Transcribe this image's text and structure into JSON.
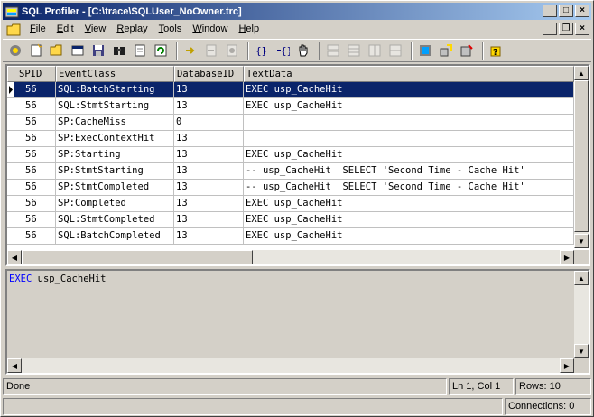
{
  "window": {
    "title": "SQL Profiler - [C:\\trace\\SQLUser_NoOwner.trc]",
    "caption_buttons": [
      "_",
      "□",
      "×"
    ]
  },
  "menu": {
    "items": [
      {
        "label": "File",
        "accel": "F",
        "rest": "ile"
      },
      {
        "label": "Edit",
        "accel": "E",
        "rest": "dit"
      },
      {
        "label": "View",
        "accel": "V",
        "rest": "iew"
      },
      {
        "label": "Replay",
        "accel": "R",
        "rest": "eplay"
      },
      {
        "label": "Tools",
        "accel": "T",
        "rest": "ools"
      },
      {
        "label": "Window",
        "accel": "W",
        "rest": "indow"
      },
      {
        "label": "Help",
        "accel": "H",
        "rest": "elp"
      }
    ],
    "mdi_buttons": [
      "_",
      "❐",
      "×"
    ]
  },
  "toolbar": {
    "icons": [
      "new-trace-icon",
      "new-template-icon",
      "open-icon",
      "properties-icon",
      "save-icon",
      "find-icon",
      "clear-trace-icon",
      "replay-icon",
      "step-icon",
      "run-to-cursor-icon",
      "toggle-breakpoint-icon",
      "stop-icon",
      "pause-icon",
      "window-tile-icon",
      "window-cascade-icon",
      "window-horizontal-icon",
      "window-vertical-icon",
      "query-analyzer-icon",
      "performance-monitor-icon",
      "index-tuning-icon",
      "help-icon"
    ]
  },
  "grid": {
    "columns": [
      "SPID",
      "EventClass",
      "DatabaseID",
      "TextData"
    ],
    "rows": [
      {
        "spid": "56",
        "event": "SQL:BatchStarting",
        "db": "13",
        "text": "EXEC usp_CacheHit",
        "selected": true
      },
      {
        "spid": "56",
        "event": "SQL:StmtStarting",
        "db": "13",
        "text": "EXEC usp_CacheHit"
      },
      {
        "spid": "56",
        "event": "SP:CacheMiss",
        "db": "0",
        "text": ""
      },
      {
        "spid": "56",
        "event": "SP:ExecContextHit",
        "db": "13",
        "text": ""
      },
      {
        "spid": "56",
        "event": "SP:Starting",
        "db": "13",
        "text": "EXEC usp_CacheHit"
      },
      {
        "spid": "56",
        "event": "SP:StmtStarting",
        "db": "13",
        "text": "-- usp_CacheHit  SELECT 'Second Time - Cache Hit'"
      },
      {
        "spid": "56",
        "event": "SP:StmtCompleted",
        "db": "13",
        "text": "-- usp_CacheHit  SELECT 'Second Time - Cache Hit'"
      },
      {
        "spid": "56",
        "event": "SP:Completed",
        "db": "13",
        "text": "EXEC usp_CacheHit"
      },
      {
        "spid": "56",
        "event": "SQL:StmtCompleted",
        "db": "13",
        "text": "EXEC usp_CacheHit"
      },
      {
        "spid": "56",
        "event": "SQL:BatchCompleted",
        "db": "13",
        "text": "EXEC usp_CacheHit"
      }
    ]
  },
  "textpane": {
    "keyword": "EXEC",
    "rest": " usp_CacheHit"
  },
  "status": {
    "message": "Done",
    "position": "Ln 1, Col 1",
    "rows": "Rows: 10",
    "connections": "Connections: 0"
  }
}
